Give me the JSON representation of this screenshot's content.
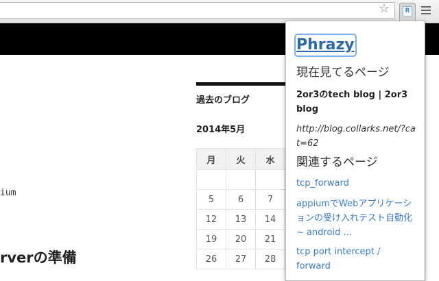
{
  "browser": {
    "star_glyph": "☆",
    "extension_icon_text": "R",
    "menu_icon": "hamburger-menu-icon"
  },
  "page": {
    "code_fragment": "ium",
    "heading_fragment": "rverの準備",
    "sidebar_title": "過去のブログ",
    "calendar": {
      "caption": "2014年5月",
      "headers": [
        "月",
        "火",
        "水"
      ],
      "rows": [
        [
          "",
          "",
          ""
        ],
        [
          "5",
          "6",
          "7"
        ],
        [
          "12",
          "13",
          "14"
        ],
        [
          "19",
          "20",
          "21"
        ],
        [
          "26",
          "27",
          "28"
        ]
      ]
    }
  },
  "popup": {
    "title": "Phrazy",
    "current_heading": "現在見てるページ",
    "current_title": "2or3のtech blog | 2or3 blog",
    "current_url": "http://blog.collarks.net/?cat=62",
    "related_heading": "関連するページ",
    "related_links": [
      "tcp_forward",
      "appiumでWebアプリケーションの受け入れテスト自動化 ~ android ...",
      "tcp port intercept / forward"
    ]
  },
  "colors": {
    "link": "#3a7cc7",
    "title": "#2c6aa7",
    "focus_ring": "#7aaef0"
  }
}
